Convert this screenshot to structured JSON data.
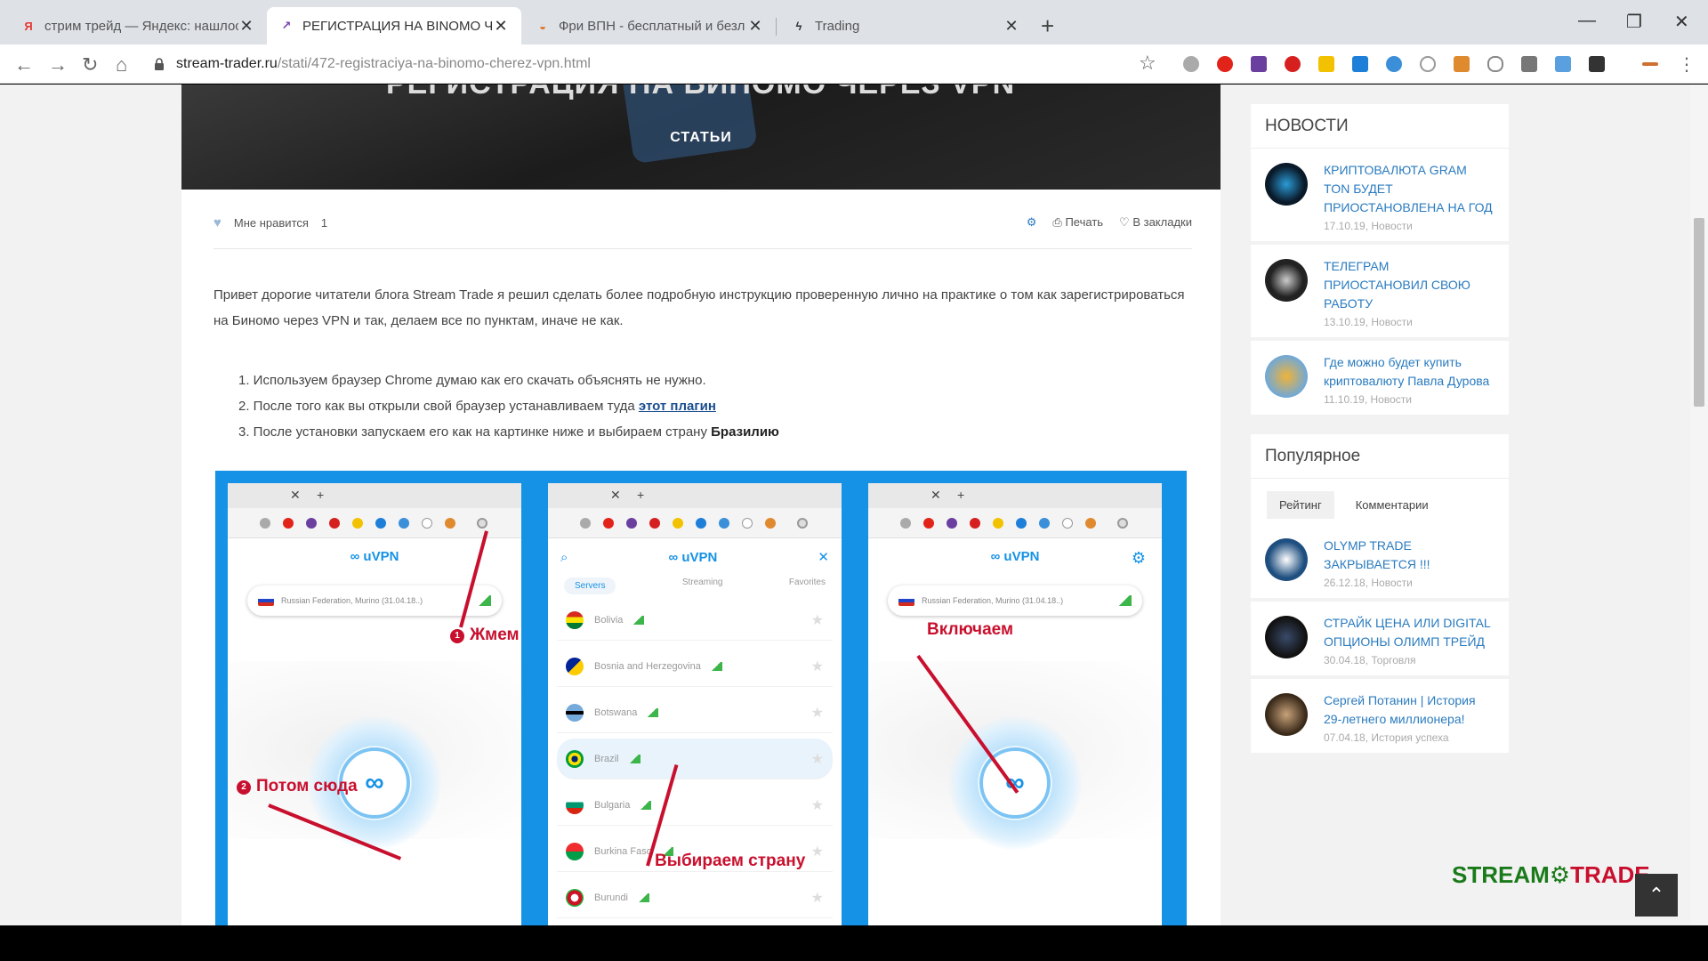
{
  "browser": {
    "tabs": [
      {
        "title": "стрим трейд — Яндекс: нашлось",
        "favicon": "Я",
        "active": false
      },
      {
        "title": "РЕГИСТРАЦИЯ НА BINOMO ЧЕ",
        "favicon": "↗",
        "active": true
      },
      {
        "title": "Фри ВПН - бесплатный и безл",
        "favicon": "◒",
        "active": false
      },
      {
        "title": "Trading",
        "favicon": "ϟ",
        "active": false
      }
    ],
    "url_host": "stream-trader.ru",
    "url_path": "/stati/472-registraciya-na-binomo-cherez-vpn.html"
  },
  "article": {
    "hero_title": "РЕГИСТРАЦИЯ НА БИНОМО ЧЕРЕЗ VPN",
    "hero_category": "СТАТЬИ",
    "like_label": "Мне нравится",
    "like_count": "1",
    "print_label": "Печать",
    "bookmark_label": "В закладки",
    "intro": "Привет дорогие читатели блога Stream Trade я решил сделать более подробную инструкцию проверенную лично на практике о том как зарегистрироваться на Биномо через VPN и так, делаем все по пунктам, иначе не как.",
    "step1": "1. Используем браузер Chrome думаю как его скачать объяснять не нужно.",
    "step2_prefix": "2. После того как вы открыли свой браузер устанавливаем туда ",
    "step2_link": "этот плагин",
    "step3_prefix": "3. После установки запускаем его как на картинке ниже и выбираем страну ",
    "step3_bold": "Бразилию"
  },
  "screenshot": {
    "logo": "∞ uVPN",
    "location_text": "Russian Federation, Murino (31.04.18..)",
    "note_press": "Жмем",
    "note_then": "Потом сюда",
    "note_choose": "Выбираем страну",
    "note_enable": "Включаем",
    "tab_servers": "Servers",
    "tab_streaming": "Streaming",
    "tab_favorites": "Favorites",
    "countries": [
      {
        "name": "Bolivia",
        "flag": "linear-gradient(#d52b1e 0 33%, #f9e300 33% 66%, #007934 66%)"
      },
      {
        "name": "Bosnia and Herzegovina",
        "flag": "linear-gradient(135deg, #002395 50%, #fecb00 50%)"
      },
      {
        "name": "Botswana",
        "flag": "linear-gradient(#75aadb 0 40%, #000 40% 60%, #75aadb 60%)"
      },
      {
        "name": "Brazil",
        "flag": "radial-gradient(circle, #002776 25%, #fedf00 26% 50%, #009b3a 51%)"
      },
      {
        "name": "Bulgaria",
        "flag": "linear-gradient(#fff 0 33%, #00966e 33% 66%, #d62612 66%)"
      },
      {
        "name": "Burkina Faso",
        "flag": "linear-gradient(#ef2b2d 0 50%, #009e49 50%)"
      },
      {
        "name": "Burundi",
        "flag": "radial-gradient(circle, #fff 30%, #ce1126 31% 60%, #1eb53a 61%)"
      }
    ]
  },
  "sidebar": {
    "news_title": "НОВОСТИ",
    "news": [
      {
        "title": "КРИПТОВАЛЮТА GRAM TON БУДЕТ ПРИОСТАНОВЛЕНА НА ГОД",
        "meta": "17.10.19, Новости",
        "thumb": "radial-gradient(circle, #2b9bd6 0%, #0a1a2a 60%)"
      },
      {
        "title": "ТЕЛЕГРАМ ПРИОСТАНОВИЛ СВОЮ РАБОТУ",
        "meta": "13.10.19, Новости",
        "thumb": "radial-gradient(circle, #ccc 0%, #222 55%)"
      },
      {
        "title": "Где можно будет купить криптовалюту Павла Дурова",
        "meta": "11.10.19, Новости",
        "thumb": "radial-gradient(circle, #f0b33a 0%, #6fa8d8 70%)"
      }
    ],
    "popular_title": "Популярное",
    "tab_rating": "Рейтинг",
    "tab_comments": "Комментарии",
    "popular": [
      {
        "title": "OLYMP TRADE ЗАКРЫВАЕТСЯ !!!",
        "meta": "26.12.18, Новости",
        "thumb": "radial-gradient(circle, #fff 0%, #1f4f80 60%)"
      },
      {
        "title": "СТРАЙК ЦЕНА ИЛИ Digital ОПЦИОНЫ ОЛИМП ТРЕЙД",
        "meta": "30.04.18, Торговля",
        "thumb": "radial-gradient(circle, #3a4a6a 0%, #111 65%)"
      },
      {
        "title": "Сергей Потанин | История 29-летнего миллионера!",
        "meta": "07.04.18, История успеха",
        "thumb": "radial-gradient(circle, #c8a27a 0%, #3a2a1a 65%)"
      }
    ]
  },
  "watermark": {
    "part1": "STREAM",
    "part2": "TRADE"
  },
  "colors": {
    "accent": "#1592e6",
    "link": "#2a7bbf",
    "note": "#c8102e"
  }
}
